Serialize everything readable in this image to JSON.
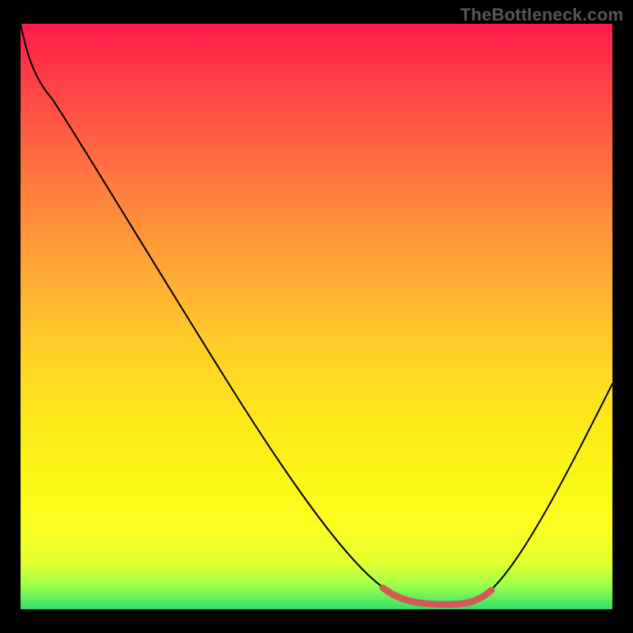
{
  "watermark": "TheBottleneck.com",
  "colors": {
    "gradient_top": "#ff1a4a",
    "gradient_mid1": "#ff9b38",
    "gradient_mid2": "#fde91a",
    "gradient_bottom": "#33e06a",
    "curve": "#000000",
    "highlight": "#d15a5a",
    "background": "#000000",
    "watermark_text": "#575757"
  },
  "chart_data": {
    "type": "line",
    "title": "",
    "xlabel": "",
    "ylabel": "",
    "xlim": [
      0,
      100
    ],
    "ylim": [
      0,
      100
    ],
    "x": [
      0,
      2,
      5,
      10,
      20,
      30,
      40,
      50,
      55,
      60,
      64,
      68,
      72,
      76,
      80,
      85,
      90,
      95,
      100
    ],
    "values": [
      100,
      95,
      90,
      85,
      72,
      58,
      44,
      28,
      18,
      10,
      4,
      1,
      0,
      0,
      1,
      6,
      18,
      30,
      38
    ],
    "series": [
      {
        "name": "bottleneck-curve",
        "x": [
          0,
          2,
          5,
          10,
          20,
          30,
          40,
          50,
          55,
          60,
          64,
          68,
          72,
          76,
          80,
          85,
          90,
          95,
          100
        ],
        "y": [
          100,
          95,
          90,
          85,
          72,
          58,
          44,
          28,
          18,
          10,
          4,
          1,
          0,
          0,
          1,
          6,
          18,
          30,
          38
        ]
      }
    ],
    "highlight_region": {
      "x_start": 62,
      "x_end": 80,
      "y": 0
    },
    "annotations": []
  }
}
